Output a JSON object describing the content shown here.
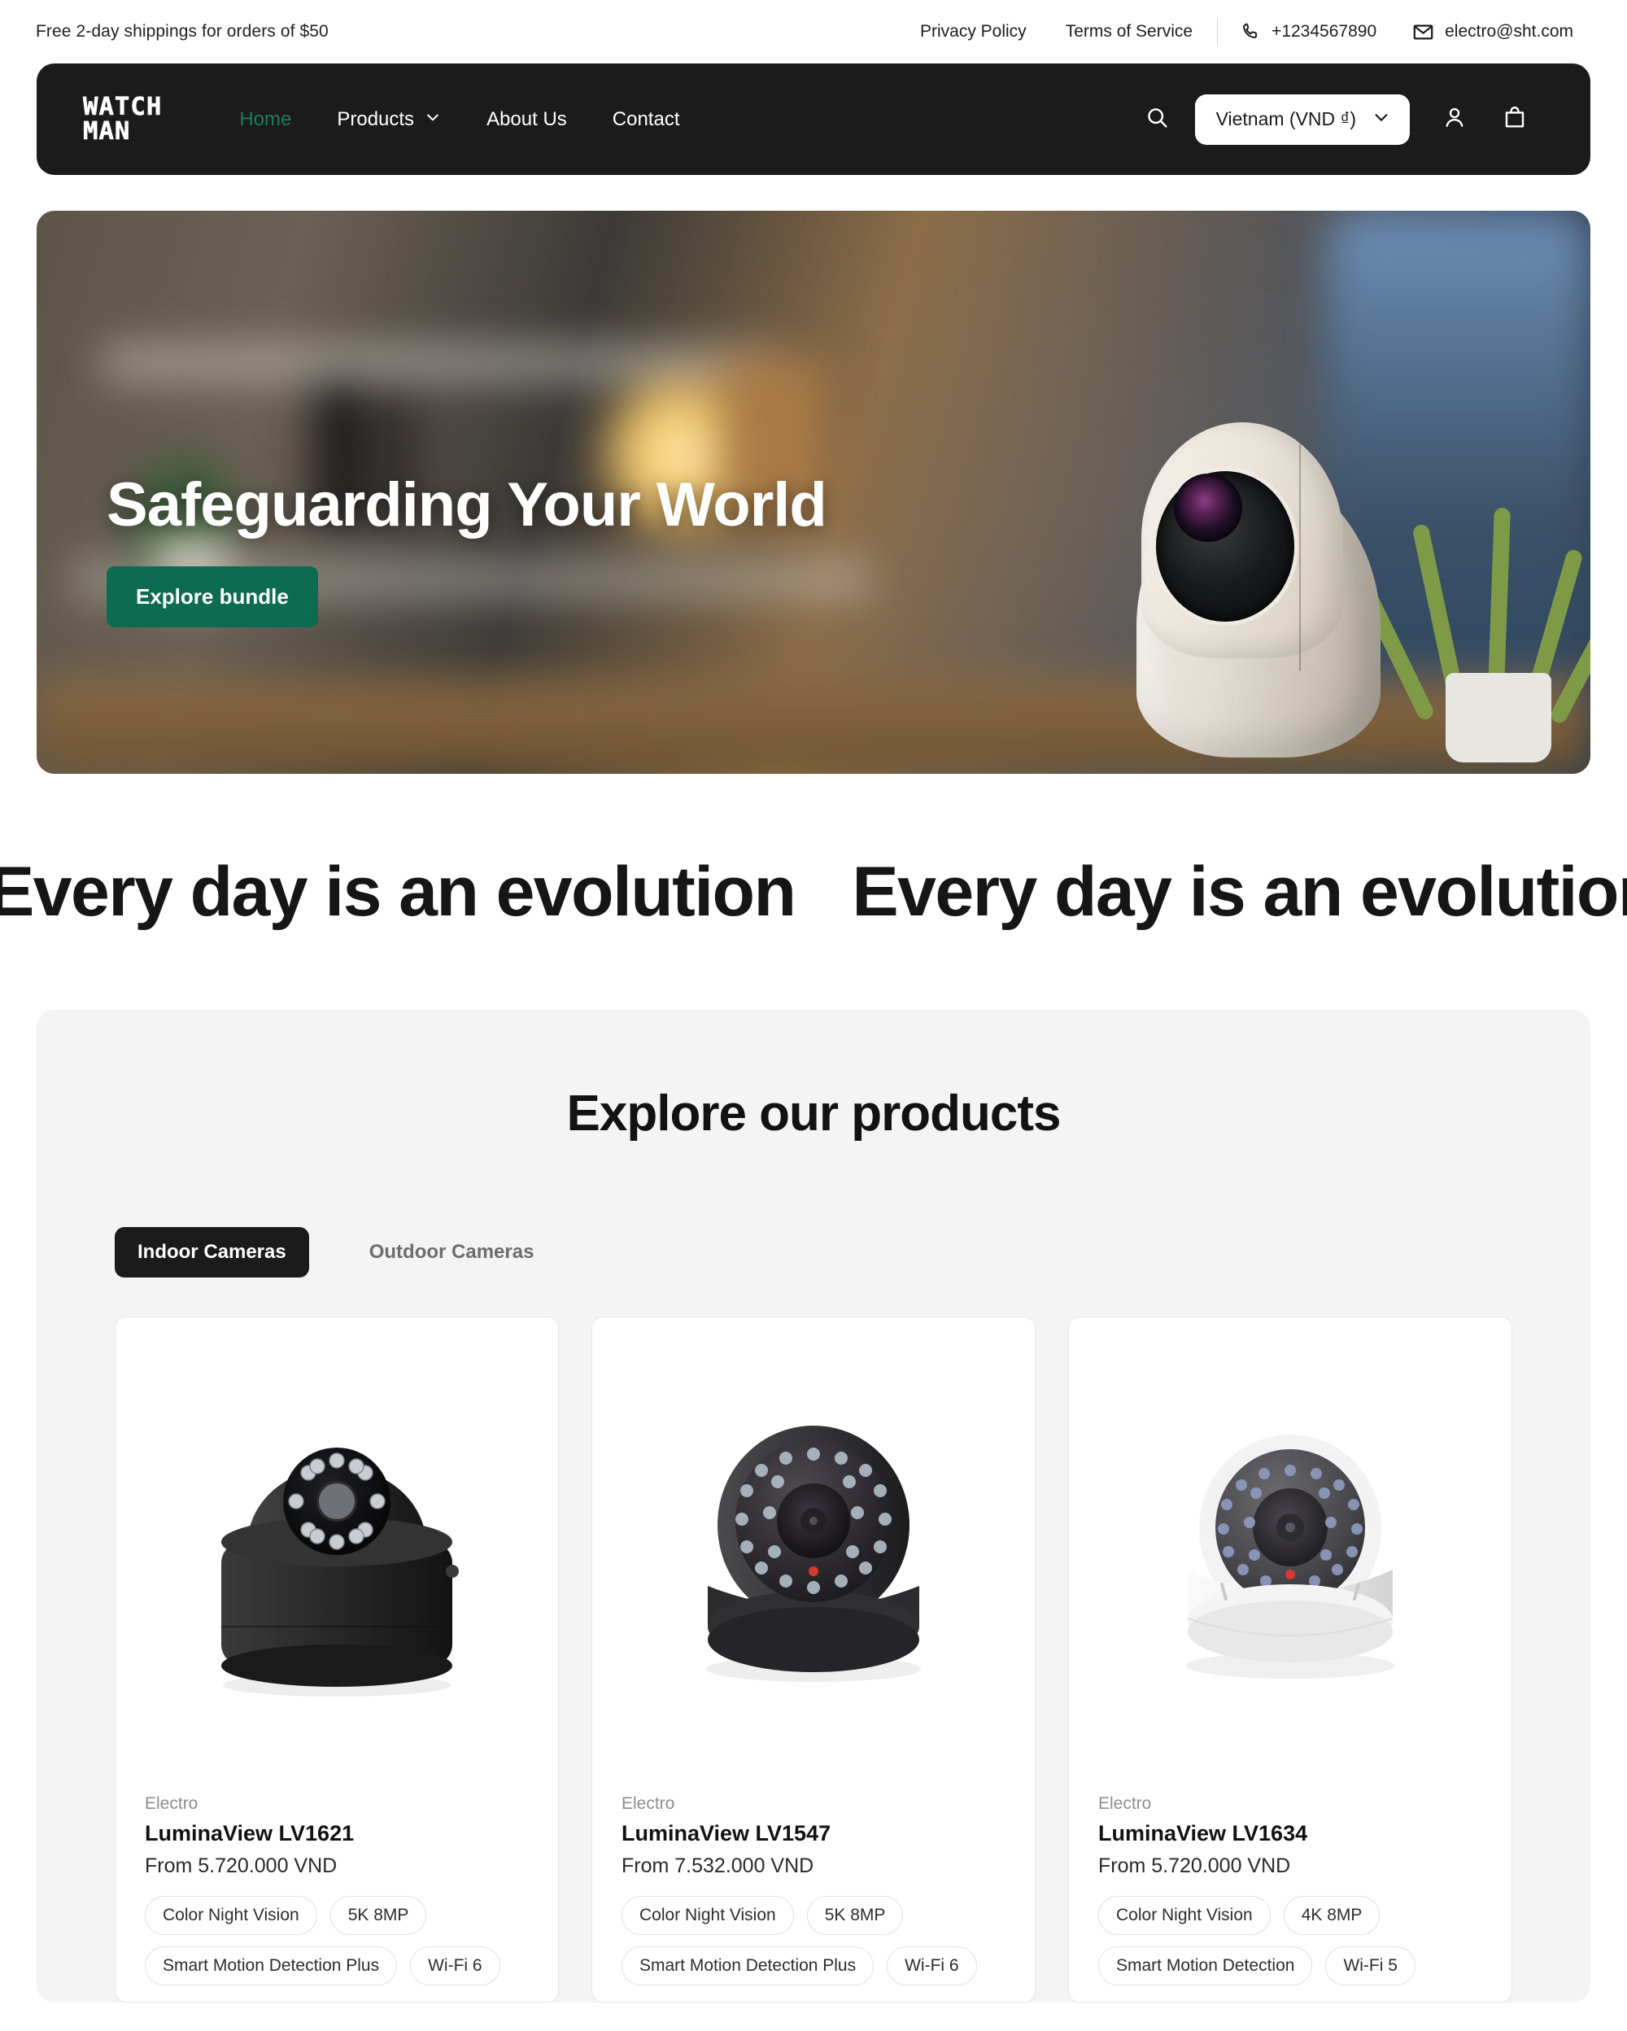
{
  "announcement": {
    "promo": "Free 2-day shippings for orders of $50",
    "links": [
      "Privacy Policy",
      "Terms of Service"
    ],
    "phone": "+1234567890",
    "email": "electro@sht.com",
    "phone_icon": "phone-icon",
    "email_icon": "envelope-icon"
  },
  "header": {
    "logo_line1": "WATCH",
    "logo_line2": "MAN",
    "nav": [
      {
        "label": "Home",
        "active": true,
        "has_chevron": false
      },
      {
        "label": "Products",
        "active": false,
        "has_chevron": true
      },
      {
        "label": "About Us",
        "active": false,
        "has_chevron": false
      },
      {
        "label": "Contact",
        "active": false,
        "has_chevron": false
      }
    ],
    "search_icon": "search-icon",
    "locale_label": "Vietnam (VND ₫)",
    "locale_chevron": "chevron-down-icon",
    "account_icon": "user-icon",
    "cart_icon": "shopping-bag-icon",
    "bg_color": "#1b1b1b",
    "active_color": "#1f7a5c"
  },
  "hero": {
    "title": "Safeguarding Your World",
    "cta_label": "Explore bundle",
    "cta_color": "#0d6b52",
    "image_alt": "white smart security camera on a desk in a blurred living room"
  },
  "marquee": {
    "text": "Every day is an evolution",
    "repeats": 3
  },
  "products_section": {
    "title": "Explore our products",
    "bg_color": "#f4f4f4",
    "tabs": [
      {
        "label": "Indoor Cameras",
        "active": true
      },
      {
        "label": "Outdoor Cameras",
        "active": false
      }
    ],
    "cards": [
      {
        "vendor": "Electro",
        "title": "LuminaView LV1621",
        "price": "From 5.720.000 VND",
        "tags": [
          "Color Night Vision",
          "5K 8MP",
          "Smart Motion Detection Plus",
          "Wi-Fi 6"
        ],
        "image_alt": "black dome security camera with infrared LED ring",
        "image_style": "black-dome-ir"
      },
      {
        "vendor": "Electro",
        "title": "LuminaView LV1547",
        "price": "From 7.532.000 VND",
        "tags": [
          "Color Night Vision",
          "5K 8MP",
          "Smart Motion Detection Plus",
          "Wi-Fi 6"
        ],
        "image_alt": "dark grey turret dome camera with many IR LEDs and red indicator",
        "image_style": "dark-turret"
      },
      {
        "vendor": "Electro",
        "title": "LuminaView LV1634",
        "price": "From 5.720.000 VND",
        "tags": [
          "Color Night Vision",
          "4K 8MP",
          "Smart Motion Detection",
          "Wi-Fi 5"
        ],
        "image_alt": "white vandal-proof dome camera with tinted bubble",
        "image_style": "white-dome"
      }
    ]
  }
}
